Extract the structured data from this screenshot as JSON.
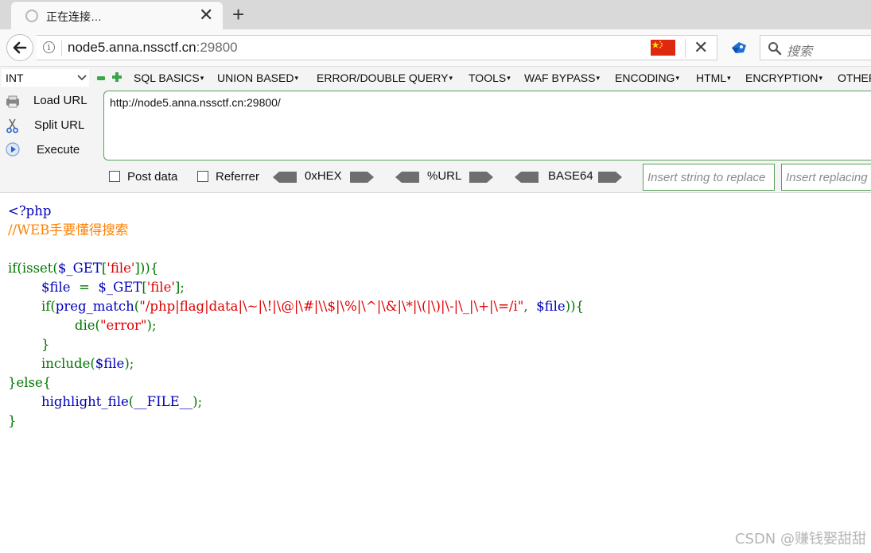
{
  "browser": {
    "tab_title": "正在连接…",
    "url_host": "node5.anna.nssctf.cn",
    "url_port": ":29800",
    "search_placeholder": "搜索",
    "colors": {
      "flag": "#de2910",
      "accent_green": "#3aa64a"
    }
  },
  "hackbar": {
    "select_value": "INT",
    "menus": [
      "SQL BASICS",
      "UNION BASED",
      "ERROR/DOUBLE QUERY",
      "TOOLS",
      "WAF BYPASS",
      "ENCODING",
      "HTML",
      "ENCRYPTION",
      "OTHER"
    ],
    "actions": [
      "Load URL",
      "Split URL",
      "Execute"
    ],
    "url_value": "http://node5.anna.nssctf.cn:29800/",
    "post_data_label": "Post data",
    "referrer_label": "Referrer",
    "encoders": [
      "0xHEX",
      "%URL",
      "BASE64"
    ],
    "replace_placeholder": "Insert string to replace",
    "replacing_placeholder": "Insert replacing string"
  },
  "code_lines": {
    "l1": "<?php",
    "l2": "//WEB手要懂得搜索",
    "l4a": "if(isset(",
    "l4b": "$_GET",
    "l4c": "[",
    "l4d": "'file'",
    "l4e": "])){",
    "l5a": "        ",
    "l5b": "$file",
    "l5c": "  =  ",
    "l5d": "$_GET",
    "l5e": "[",
    "l5f": "'file'",
    "l5g": "];",
    "l6a": "        if(",
    "l6b": "preg_match",
    "l6c": "(",
    "l6d": "\"/php|flag|data|\\~|\\!|\\@|\\#|\\\\$|\\%|\\^|\\&|\\*|\\(|\\)|\\-|\\_|\\+|\\=/i\"",
    "l6e": ",  ",
    "l6f": "$file",
    "l6g": ")){",
    "l7a": "                die(",
    "l7b": "\"error\"",
    "l7c": ");",
    "l8": "        }",
    "l9a": "        include(",
    "l9b": "$file",
    "l9c": ");",
    "l10": "}else{",
    "l11a": "        ",
    "l11b": "highlight_file",
    "l11c": "(",
    "l11d": "__FILE__",
    "l11e": ");",
    "l12": "}"
  },
  "watermark": "CSDN @赚钱娶甜甜"
}
